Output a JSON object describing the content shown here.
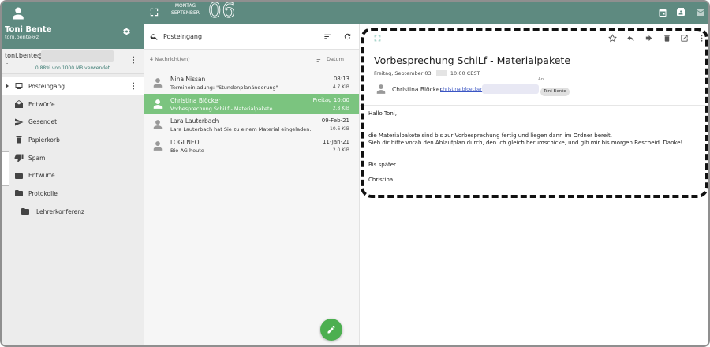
{
  "sidebar": {
    "user_name": "Toni Bente",
    "user_email": "toni.bente@z",
    "account_email": "toni.bente@",
    "account_dot": "-",
    "quota_text": "0.88% von 1000 MB verwendet",
    "folders": [
      {
        "label": "Posteingang",
        "icon": "inbox-icon"
      },
      {
        "label": "Entwürfe",
        "icon": "drafts-icon"
      },
      {
        "label": "Gesendet",
        "icon": "send-icon"
      },
      {
        "label": "Papierkorb",
        "icon": "trash-icon"
      },
      {
        "label": "Spam",
        "icon": "thumbs-down-icon"
      },
      {
        "label": "Entwürfe",
        "icon": "folder-icon"
      },
      {
        "label": "Protokolle",
        "icon": "folder-icon"
      },
      {
        "label": "Lehrerkonferenz",
        "icon": "folder-icon"
      }
    ]
  },
  "topbar": {
    "month_line1": "MONTAG",
    "month_line2": "SEPTEMBER",
    "day": "06"
  },
  "list": {
    "folder_name": "Posteingang",
    "count": "4 Nachricht(en)",
    "sort_label": "Datum",
    "messages": [
      {
        "sender": "Nina Nissan",
        "subject": "Termineinladung: \"Stundenplanänderung\"",
        "date": "08:13",
        "size": "4.7 KiB"
      },
      {
        "sender": "Christina Blöcker",
        "subject": "Vorbesprechung SchiLf - Materialpakete",
        "date": "Freitag 10:00",
        "size": "2.8 KiB"
      },
      {
        "sender": "Lara Lauterbach",
        "subject": "Lara Lauterbach hat Sie zu einem Material eingeladen.",
        "date": "09-Feb-21",
        "size": "10.6 KiB"
      },
      {
        "sender": "LOGI NEO",
        "subject": "Bio-AG heute",
        "date": "11-Jan-21",
        "size": "2.0 KiB"
      }
    ]
  },
  "reader": {
    "subject": "Vorbesprechung SchiLf - Materialpakete",
    "date_prefix": "Freitag, September 03,",
    "date_suffix": "10:00 CEST",
    "from_name": "Christina Blöcker",
    "from_email": "christina.bloecker@",
    "to_label": "An",
    "to_name": "Toni Bente",
    "body": {
      "greeting": "Hallo Toni,",
      "line1": "die Materialpakete sind bis zur Vorbesprechung fertig und liegen dann im Ordner bereit.",
      "line2": "Sieh dir bitte vorab den Ablaufplan durch, den ich gleich herumschicke, und gib mir bis morgen Bescheid. Danke!",
      "closing": "Bis später",
      "signature": "Christina"
    }
  },
  "colors": {
    "brand": "#5e8a80",
    "selected": "#7bc47f",
    "fab": "#4caf50"
  }
}
